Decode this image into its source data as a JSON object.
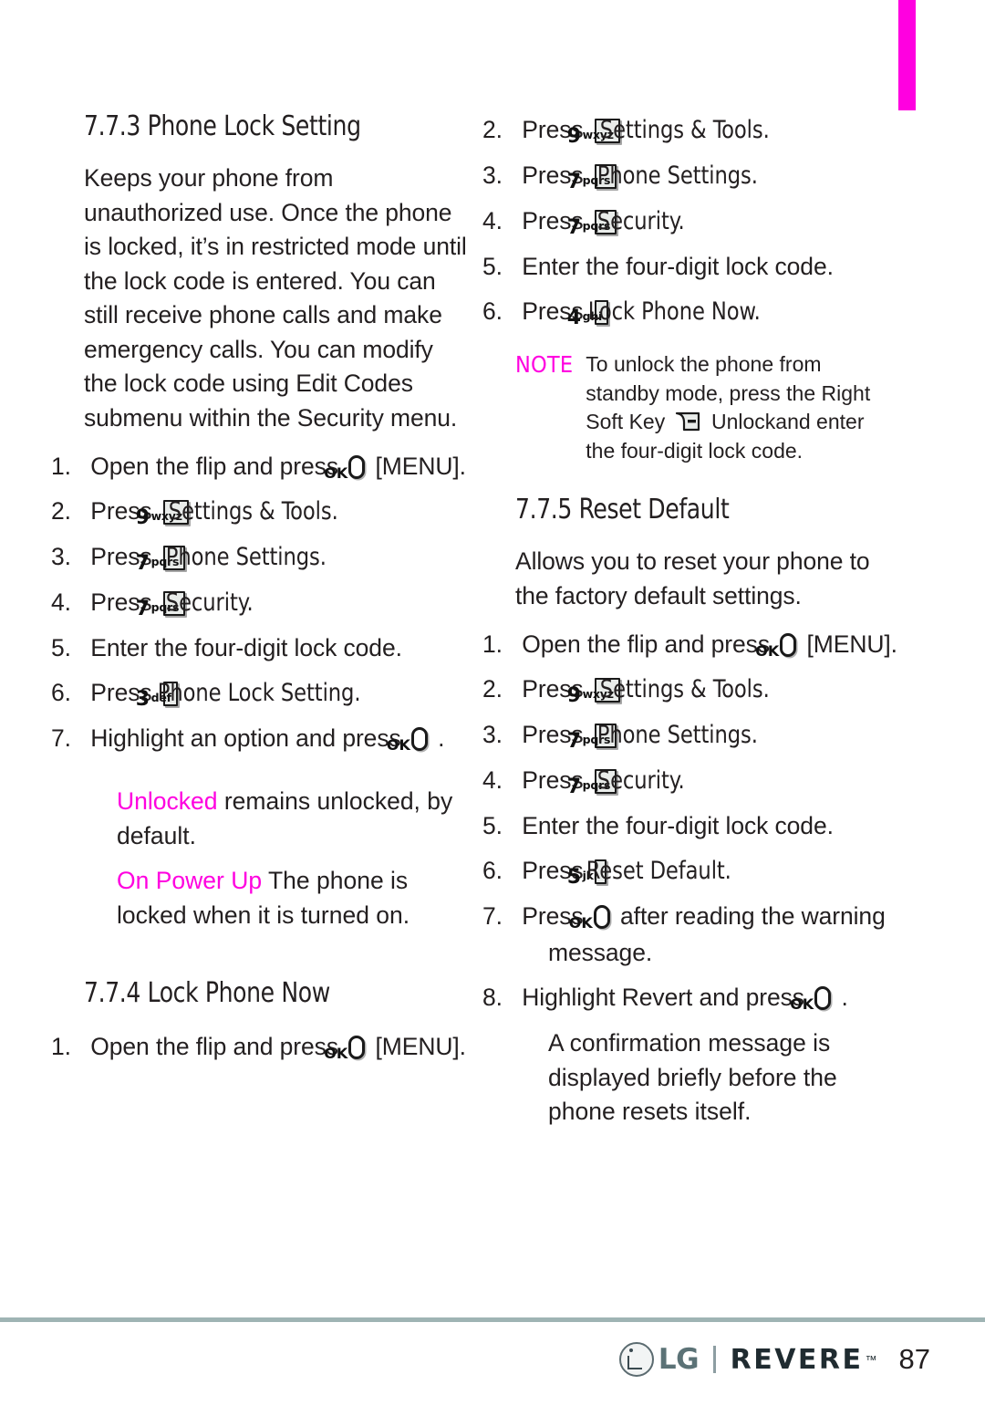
{
  "page": {
    "number": "87",
    "tab_marker_color": "#ff00e0",
    "accent_color": "#ff00e0"
  },
  "footer": {
    "brand": "LG",
    "product": "REVERE",
    "trademark": "™",
    "page_number": "87"
  },
  "left_column": {
    "heading": "7.7.3 Phone Lock Setting",
    "intro": "Keeps your phone from unauthorized use. Once the phone is locked, it’s in restricted mode until the lock code is entered. You can still receive phone calls and make emergency calls. You can modify the lock code using Edit Codes submenu within the Security menu.",
    "steps": [
      {
        "num": "1.",
        "pre": "Open the flip and press",
        "key": {
          "type": "ok",
          "label": "OK"
        },
        "post": "[MENU]."
      },
      {
        "num": "2.",
        "pre": "Press",
        "key": {
          "type": "keypad",
          "digit": "9",
          "letters": "wxyz"
        },
        "post": "Settings & Tools."
      },
      {
        "num": "3.",
        "pre": "Press",
        "key": {
          "type": "keypad",
          "digit": "7",
          "letters": "pqrs"
        },
        "post": "Phone Settings."
      },
      {
        "num": "4.",
        "pre": "Press",
        "key": {
          "type": "keypad",
          "digit": "7",
          "letters": "pqrs"
        },
        "post": "Security."
      },
      {
        "num": "5.",
        "pre": "Enter the four-digit lock code.",
        "key": null,
        "post": ""
      },
      {
        "num": "6.",
        "pre": "Press",
        "key": {
          "type": "keypad",
          "digit": "3",
          "letters": "def"
        },
        "post": "Phone Lock Setting."
      },
      {
        "num": "7.",
        "pre": "Highlight an option and press",
        "key": {
          "type": "ok",
          "label": "OK"
        },
        "post": "."
      }
    ],
    "options": [
      {
        "name": "Unlocked",
        "description": "remains unlocked, by default."
      },
      {
        "name": "On Power Up",
        "description": "The phone is locked when it is turned on."
      }
    ],
    "heading2": "7.7.4 Lock Phone Now",
    "steps2": [
      {
        "num": "1.",
        "pre": "Open the flip and press",
        "key": {
          "type": "ok",
          "label": "OK"
        },
        "post": "[MENU]."
      }
    ]
  },
  "right_column": {
    "steps_continued": [
      {
        "num": "2.",
        "pre": "Press",
        "key": {
          "type": "keypad",
          "digit": "9",
          "letters": "wxyz"
        },
        "post": "Settings & Tools."
      },
      {
        "num": "3.",
        "pre": "Press",
        "key": {
          "type": "keypad",
          "digit": "7",
          "letters": "pqrs"
        },
        "post": "Phone Settings."
      },
      {
        "num": "4.",
        "pre": "Press",
        "key": {
          "type": "keypad",
          "digit": "7",
          "letters": "pqrs"
        },
        "post": "Security."
      },
      {
        "num": "5.",
        "pre": "Enter the four-digit lock code.",
        "key": null,
        "post": ""
      },
      {
        "num": "6.",
        "pre": "Press",
        "key": {
          "type": "keypad",
          "digit": "4",
          "letters": "ghi"
        },
        "post": "Lock Phone Now."
      }
    ],
    "note": {
      "label": "NOTE",
      "text_before_key": "To unlock the phone from standby mode, press the Right Soft Key",
      "key_name": "right-soft-key",
      "text_after_key": "Unlock",
      "text_end": "and enter the four-digit lock code."
    },
    "heading": "7.7.5 Reset Default",
    "intro": "Allows you to reset your phone to the factory default settings.",
    "steps": [
      {
        "num": "1.",
        "pre": "Open the flip and press",
        "key": {
          "type": "ok",
          "label": "OK"
        },
        "post": "[MENU]."
      },
      {
        "num": "2.",
        "pre": "Press",
        "key": {
          "type": "keypad",
          "digit": "9",
          "letters": "wxyz"
        },
        "post": "Settings & Tools."
      },
      {
        "num": "3.",
        "pre": "Press",
        "key": {
          "type": "keypad",
          "digit": "7",
          "letters": "pqrs"
        },
        "post": "Phone Settings."
      },
      {
        "num": "4.",
        "pre": "Press",
        "key": {
          "type": "keypad",
          "digit": "7",
          "letters": "pqrs"
        },
        "post": "Security."
      },
      {
        "num": "5.",
        "pre": "Enter the four-digit lock code.",
        "key": null,
        "post": ""
      },
      {
        "num": "6.",
        "pre": "Press",
        "key": {
          "type": "keypad",
          "digit": "5",
          "letters": "jkl"
        },
        "post": "Reset Default."
      },
      {
        "num": "7.",
        "pre": "Press",
        "key": {
          "type": "ok",
          "label": "OK"
        },
        "post": "after reading the warning message."
      },
      {
        "num": "8.",
        "pre": "Highlight Revert and press",
        "key": {
          "type": "ok",
          "label": "OK"
        },
        "post": "."
      }
    ],
    "closing": "A confirmation message is displayed briefly before the phone resets itself."
  }
}
